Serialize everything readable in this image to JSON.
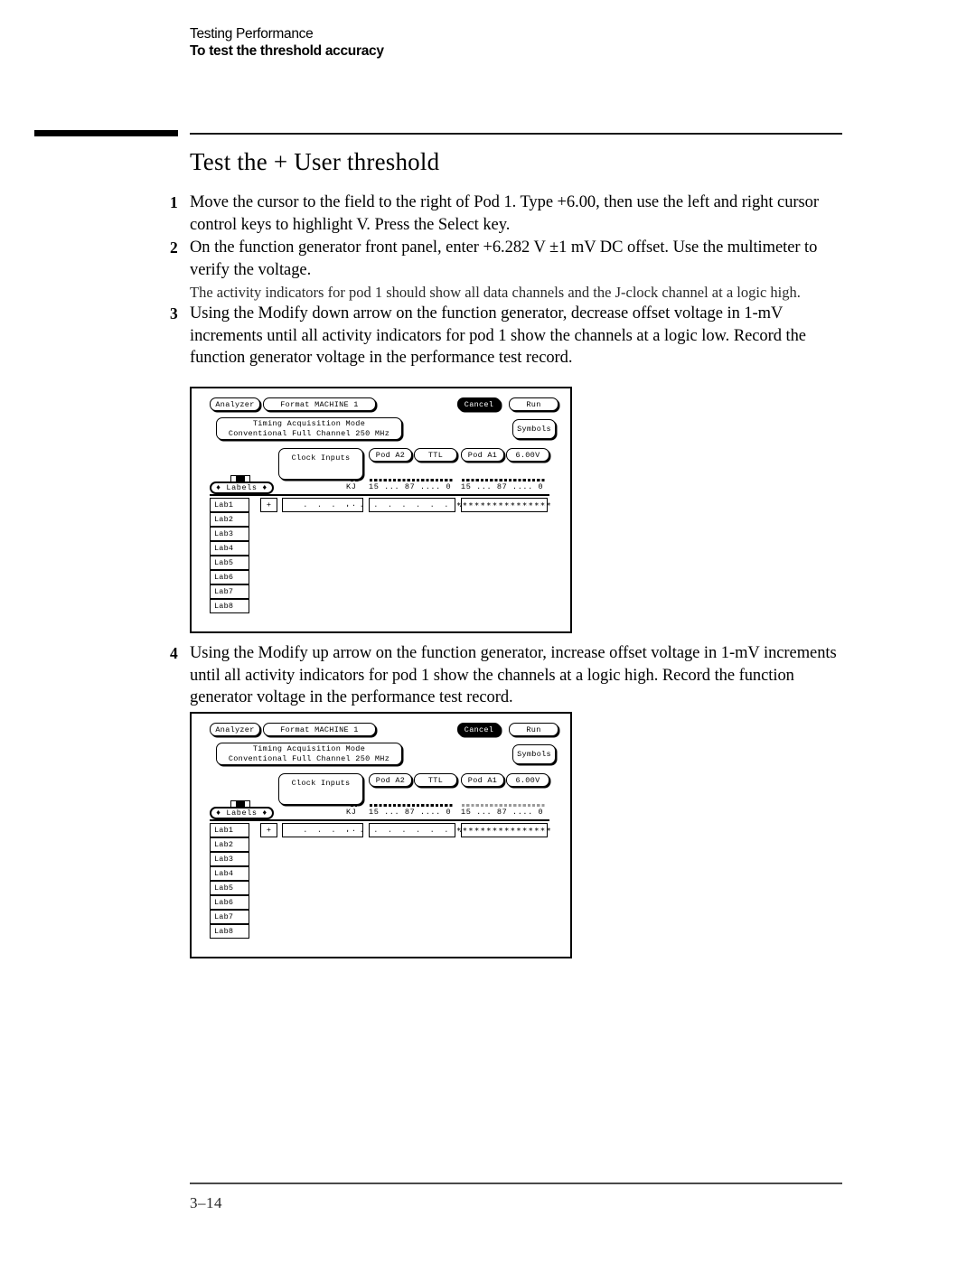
{
  "header": {
    "chapter": "Testing Performance",
    "topic": "To test the threshold accuracy"
  },
  "section_title": "Test the + User threshold",
  "steps": [
    {
      "number": "1",
      "text": "Move the cursor to the field to the right of Pod 1.  Type +6.00, then use the left and right cursor control keys to highlight V.  Press the Select key."
    },
    {
      "number": "2",
      "text": "On the function generator front panel, enter +6.282 V ±1 mV DC offset.  Use the multimeter to verify the voltage.",
      "note": "The activity indicators for pod 1 should show all data channels and the J-clock channel at a logic high."
    },
    {
      "number": "3",
      "text": "Using the Modify down arrow on the function generator, decrease offset voltage in 1-mV increments until all activity indicators for pod 1 show the channels at a logic low.  Record the function generator voltage in the performance test record."
    },
    {
      "number": "4",
      "text": "Using the Modify up arrow on the function generator, increase offset voltage in 1-mV increments until all activity indicators for pod 1 show the channels at a logic high.  Record the function generator voltage in the performance test record."
    }
  ],
  "figures": [
    {
      "id": "figure-1",
      "buttons": {
        "analyzer": "Analyzer",
        "format": "Format   MACHINE 1",
        "cancel": "Cancel",
        "run": "Run",
        "symbols": "Symbols",
        "acq_mode_line1": "Timing Acquisition Mode",
        "acq_mode_line2": "Conventional  Full Channel  250 MHz",
        "clock_inputs": "Clock Inputs",
        "pod_a2": "Pod A2",
        "ttl": "TTL",
        "pod_a1": "Pod A1",
        "threshold": "6.00V",
        "labels": "♦ Labels ♦",
        "plus": "+"
      },
      "columns": {
        "clock_head": "KJ",
        "pod_a2_head": "15 ... 87 .... 0",
        "pod_a1_head": "15 ... 87 .... 0"
      },
      "activity": {
        "clock": "..",
        "pod_a2": ". . . . . . . . . . . . . . . .",
        "pod_a1": "∗∗∗∗∗∗∗∗∗∗∗∗∗∗∗∗"
      },
      "labels_column": [
        "Lab1",
        "Lab2",
        "Lab3",
        "Lab4",
        "Lab5",
        "Lab6",
        "Lab7",
        "Lab8"
      ]
    },
    {
      "id": "figure-2",
      "buttons": {
        "analyzer": "Analyzer",
        "format": "Format   MACHINE 1",
        "cancel": "Cancel",
        "run": "Run",
        "symbols": "Symbols",
        "acq_mode_line1": "Timing Acquisition Mode",
        "acq_mode_line2": "Conventional  Full Channel  250 MHz",
        "clock_inputs": "Clock Inputs",
        "pod_a2": "Pod A2",
        "ttl": "TTL",
        "pod_a1": "Pod A1",
        "threshold": "6.00V",
        "labels": "♦ Labels ♦",
        "plus": "+"
      },
      "columns": {
        "clock_head": "KJ",
        "pod_a2_head": "15 ... 87 .... 0",
        "pod_a1_head": "15 ... 87 .... 0"
      },
      "activity": {
        "clock": "..",
        "pod_a2": ". . . . . . . . . . . . . . . .",
        "pod_a1": "∗∗∗∗∗∗∗∗∗∗∗∗∗∗∗∗"
      },
      "labels_column": [
        "Lab1",
        "Lab2",
        "Lab3",
        "Lab4",
        "Lab5",
        "Lab6",
        "Lab7",
        "Lab8"
      ]
    }
  ],
  "footer": {
    "page_number": "3–14"
  }
}
